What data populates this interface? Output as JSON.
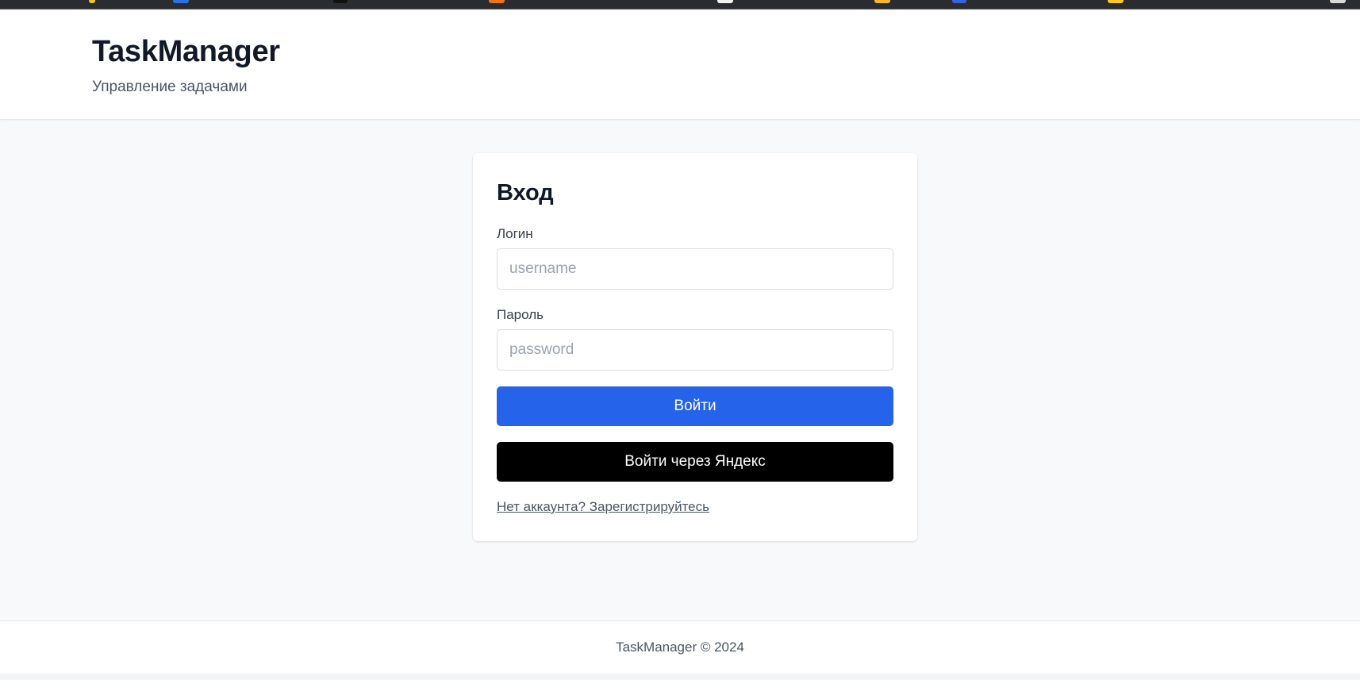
{
  "header": {
    "brand": "TaskManager",
    "tagline": "Управление задачами"
  },
  "login": {
    "title": "Вход",
    "username_label": "Логин",
    "username_placeholder": "username",
    "username_value": "",
    "password_label": "Пароль",
    "password_placeholder": "password",
    "password_value": "",
    "submit_label": "Войти",
    "yandex_label": "Войти через Яндекс",
    "register_link": "Нет аккаунта? Зарегистрируйтесь"
  },
  "footer": {
    "text": "TaskManager © 2024"
  },
  "colors": {
    "primary": "#2563eb",
    "yandex_button": "#000000",
    "page_background": "#f8f9fb",
    "card_background": "#ffffff",
    "browser_strip": "#2b2c30"
  }
}
